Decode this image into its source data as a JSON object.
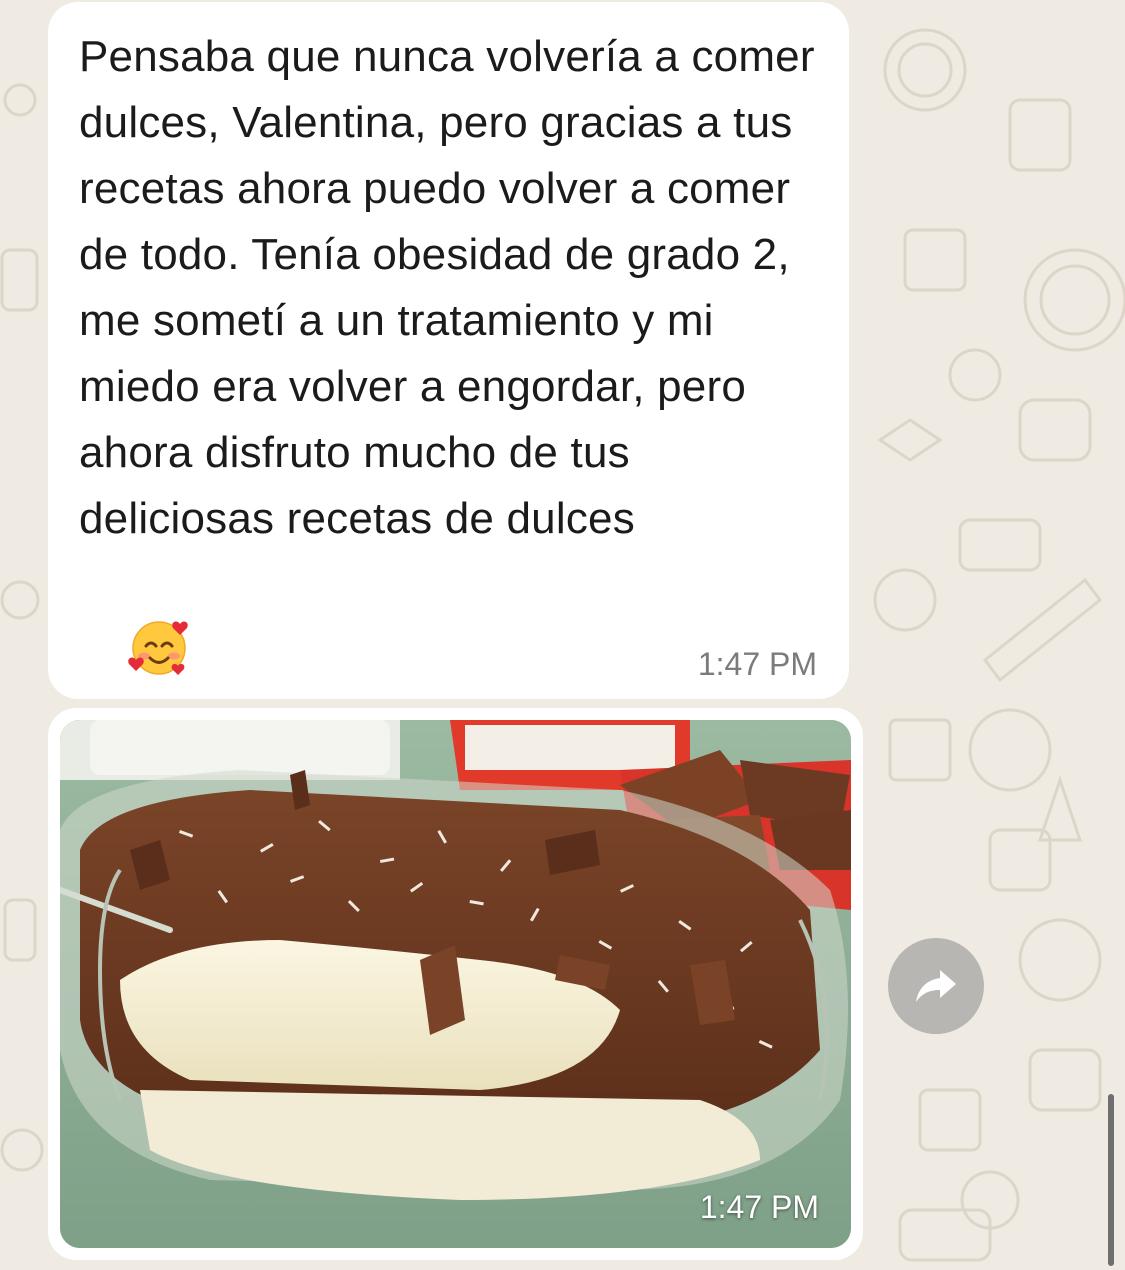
{
  "chat": {
    "messages": [
      {
        "type": "text",
        "text": "Pensaba que nunca volvería a comer dulces, Valentina, pero gracias a tus recetas ahora puedo volver a comer de todo. Tenía obesidad de grado 2, me sometí a un tratamiento y mi miedo era volver a engordar, pero ahora disfruto mucho de tus deliciosas recetas de dulces",
        "emoji": "smiling-face-with-hearts",
        "time": "1:47 PM"
      },
      {
        "type": "image",
        "image": "chocolate-coconut-dessert-photo",
        "time": "1:47 PM"
      }
    ]
  },
  "actions": {
    "forward_icon": "forward-arrow-icon"
  },
  "colors": {
    "background": "#efeae2",
    "bubble": "#ffffff",
    "timestamp": "#7b7b7b",
    "forward_button": "#b8b6b2"
  }
}
